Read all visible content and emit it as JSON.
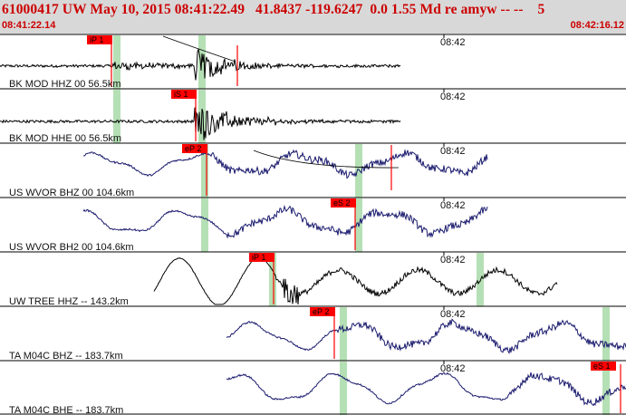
{
  "header": {
    "title": "61000417 UW May 10, 2015 08:41:22.49   41.8437 -119.6247  0.0 1.55 Md re amyw -- --    5",
    "time_start": "08:41:22.14",
    "time_end": "08:42:16.12"
  },
  "colors": {
    "header_bg": "#d8d8d8",
    "title_red": "#cc0000",
    "pick_red": "#ff0000",
    "window_green": "#b5e0b5",
    "trace_black": "#000000",
    "trace_navy": "#1a1a6e"
  },
  "tick_label": "08:42",
  "channels": [
    {
      "label": "BK MOD HHZ 00 56.5km",
      "trace_color": "black",
      "pick": "iP 1"
    },
    {
      "label": "BK MOD HHE 00 56.5km",
      "trace_color": "black",
      "pick": "iS 1"
    },
    {
      "label": "US WVOR BHZ 00 104.6km",
      "trace_color": "navy",
      "pick": "eP 2"
    },
    {
      "label": "US WVOR BH2 00 104.6km",
      "trace_color": "navy",
      "pick": "eS 2"
    },
    {
      "label": "UW TREE HHZ -- 143.2km",
      "trace_color": "black",
      "pick": "iP 1"
    },
    {
      "label": "TA M04C BHZ -- 183.7km",
      "trace_color": "navy",
      "pick": "eP 2"
    },
    {
      "label": "TA M04C BHE -- 183.7km",
      "trace_color": "navy",
      "pick": "eS 1"
    }
  ]
}
